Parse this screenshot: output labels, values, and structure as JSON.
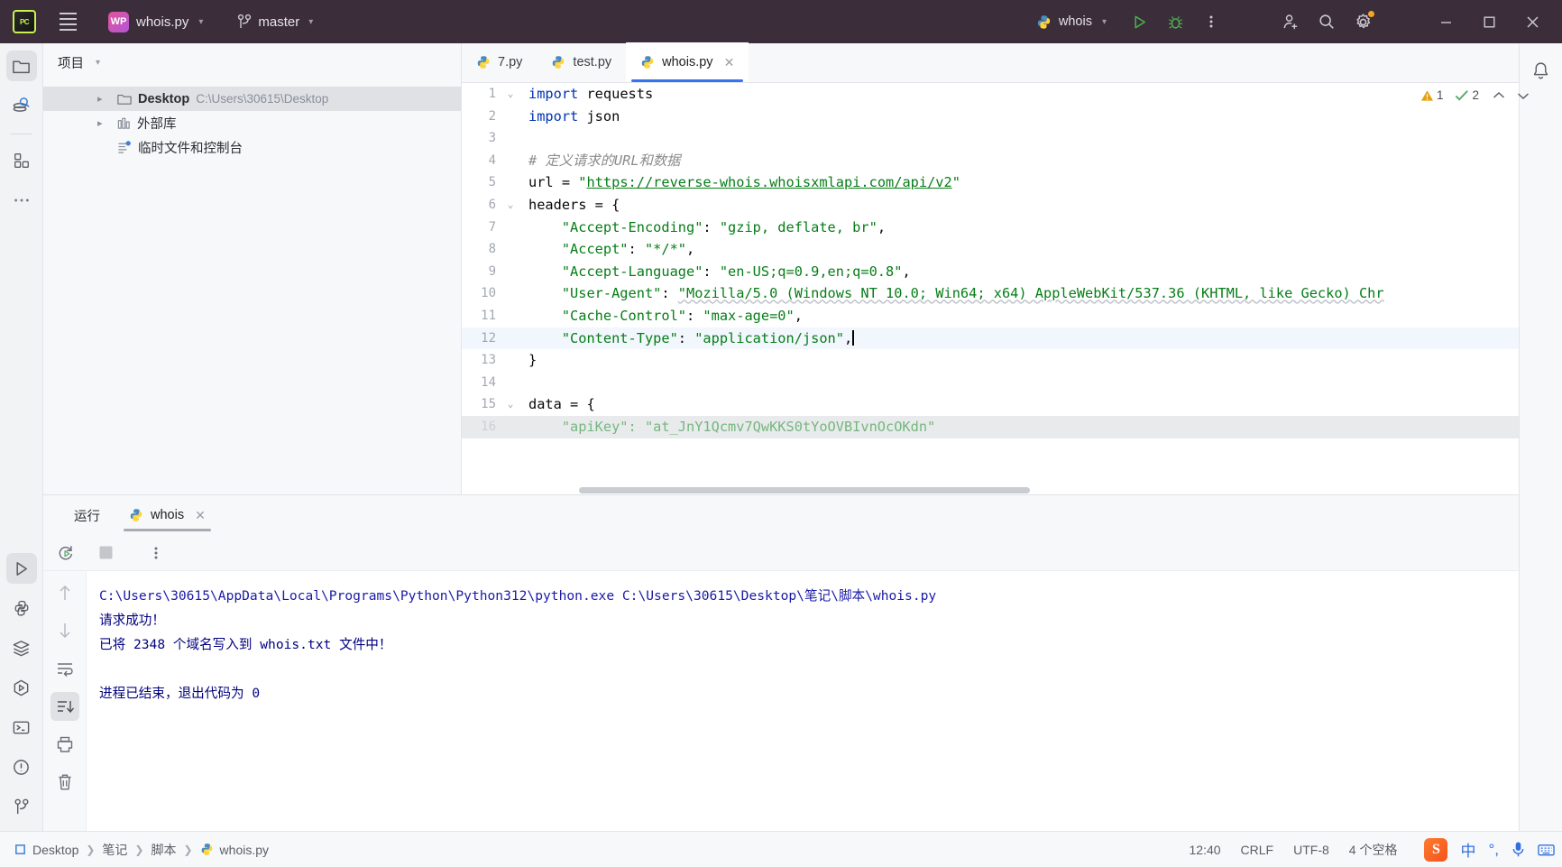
{
  "titlebar": {
    "logo_label": "PC",
    "menu_icon": "hamburger-menu-icon",
    "project_badge": "WP",
    "project_name": "whois.py",
    "branch_icon": "git-branch-icon",
    "branch_name": "master",
    "run_config": "whois",
    "run_icon": "run-icon",
    "debug_icon": "debug-icon",
    "more_icon": "more-vertical-icon",
    "share_icon": "add-user-icon",
    "search_icon": "search-icon",
    "settings_icon": "gear-icon",
    "minimize": "─",
    "maximize": "□",
    "close": "✕"
  },
  "activitybar": {
    "items": [
      {
        "name": "project-icon",
        "selected": true
      },
      {
        "name": "database-search-icon",
        "selected": false
      },
      {
        "name": "plugins-icon",
        "selected": false
      },
      {
        "name": "more-tools-icon",
        "selected": false
      }
    ],
    "bottom": [
      {
        "name": "run-tool-icon",
        "selected": true
      },
      {
        "name": "python-packages-icon",
        "selected": false
      },
      {
        "name": "structure-icon",
        "selected": false
      },
      {
        "name": "python-console-icon",
        "selected": false
      },
      {
        "name": "terminal-icon",
        "selected": false
      },
      {
        "name": "problems-icon",
        "selected": false
      },
      {
        "name": "version-control-icon",
        "selected": false
      }
    ]
  },
  "project_panel": {
    "title": "项目",
    "tree": [
      {
        "name": "Desktop",
        "path": "C:\\Users\\30615\\Desktop",
        "icon": "folder-icon",
        "expandable": true,
        "selected": true
      },
      {
        "name": "外部库",
        "path": "",
        "icon": "library-icon",
        "expandable": true,
        "selected": false
      },
      {
        "name": "临时文件和控制台",
        "path": "",
        "icon": "scratches-icon",
        "expandable": false,
        "selected": false
      }
    ]
  },
  "editor": {
    "tabs": [
      {
        "label": "7.py",
        "icon": "python-file-icon",
        "active": false,
        "closable": false
      },
      {
        "label": "test.py",
        "icon": "python-file-icon",
        "active": false,
        "closable": false
      },
      {
        "label": "whois.py",
        "icon": "python-file-icon",
        "active": true,
        "closable": true
      }
    ],
    "more_icon": "more-vertical-icon",
    "inspections": {
      "warning_icon": "warning-triangle-icon",
      "warning_count": "1",
      "ok_icon": "check-icon",
      "ok_count": "2",
      "up_icon": "chevron-up-icon",
      "down_icon": "chevron-down-icon"
    },
    "lines": [
      {
        "n": "1",
        "fold": "v",
        "cur": false,
        "segs": [
          {
            "t": "import",
            "c": "k"
          },
          {
            "t": " requests",
            "c": "plain"
          }
        ]
      },
      {
        "n": "2",
        "fold": "",
        "cur": false,
        "segs": [
          {
            "t": "import",
            "c": "k"
          },
          {
            "t": " json",
            "c": "plain"
          }
        ]
      },
      {
        "n": "3",
        "fold": "",
        "cur": false,
        "segs": []
      },
      {
        "n": "4",
        "fold": "",
        "cur": false,
        "segs": [
          {
            "t": "# 定义请求的URL和数据",
            "c": "cm"
          }
        ]
      },
      {
        "n": "5",
        "fold": "",
        "cur": false,
        "segs": [
          {
            "t": "url = ",
            "c": "plain"
          },
          {
            "t": "\"",
            "c": "s"
          },
          {
            "t": "https://reverse-whois.whoisxmlapi.com/api/v2",
            "c": "lnk"
          },
          {
            "t": "\"",
            "c": "s"
          }
        ]
      },
      {
        "n": "6",
        "fold": "v",
        "cur": false,
        "segs": [
          {
            "t": "headers = {",
            "c": "plain"
          }
        ]
      },
      {
        "n": "7",
        "fold": "",
        "cur": false,
        "segs": [
          {
            "t": "    ",
            "c": "plain"
          },
          {
            "t": "\"Accept-Encoding\"",
            "c": "s"
          },
          {
            "t": ": ",
            "c": "plain"
          },
          {
            "t": "\"gzip, deflate, br\"",
            "c": "s"
          },
          {
            "t": ",",
            "c": "plain"
          }
        ]
      },
      {
        "n": "8",
        "fold": "",
        "cur": false,
        "segs": [
          {
            "t": "    ",
            "c": "plain"
          },
          {
            "t": "\"Accept\"",
            "c": "s"
          },
          {
            "t": ": ",
            "c": "plain"
          },
          {
            "t": "\"*/*\"",
            "c": "s"
          },
          {
            "t": ",",
            "c": "plain"
          }
        ]
      },
      {
        "n": "9",
        "fold": "",
        "cur": false,
        "segs": [
          {
            "t": "    ",
            "c": "plain"
          },
          {
            "t": "\"Accept-Language\"",
            "c": "s"
          },
          {
            "t": ": ",
            "c": "plain"
          },
          {
            "t": "\"en-US;q=0.9,en;q=0.8\"",
            "c": "s"
          },
          {
            "t": ",",
            "c": "plain"
          }
        ]
      },
      {
        "n": "10",
        "fold": "",
        "cur": false,
        "segs": [
          {
            "t": "    ",
            "c": "plain"
          },
          {
            "t": "\"User-Agent\"",
            "c": "s"
          },
          {
            "t": ": ",
            "c": "plain"
          },
          {
            "t": "\"Mozilla/5.0 (Windows NT 10.0; Win64; x64) AppleWebKit/537.36 (KHTML, like Gecko) Chr",
            "c": "s wavy"
          }
        ]
      },
      {
        "n": "11",
        "fold": "",
        "cur": false,
        "segs": [
          {
            "t": "    ",
            "c": "plain"
          },
          {
            "t": "\"Cache-Control\"",
            "c": "s"
          },
          {
            "t": ": ",
            "c": "plain"
          },
          {
            "t": "\"max-age=0\"",
            "c": "s"
          },
          {
            "t": ",",
            "c": "plain"
          }
        ]
      },
      {
        "n": "12",
        "fold": "",
        "cur": true,
        "segs": [
          {
            "t": "    ",
            "c": "plain"
          },
          {
            "t": "\"Content-Type\"",
            "c": "s"
          },
          {
            "t": ": ",
            "c": "plain"
          },
          {
            "t": "\"application/json\"",
            "c": "s"
          },
          {
            "t": ",",
            "c": "plain"
          }
        ]
      },
      {
        "n": "13",
        "fold": "",
        "cur": false,
        "segs": [
          {
            "t": "}",
            "c": "plain"
          }
        ]
      },
      {
        "n": "14",
        "fold": "",
        "cur": false,
        "segs": []
      },
      {
        "n": "15",
        "fold": "v",
        "cur": false,
        "segs": [
          {
            "t": "data = {",
            "c": "plain"
          }
        ]
      },
      {
        "n": "16",
        "fold": "",
        "cur": false,
        "segs": [
          {
            "t": "    ",
            "c": "plain"
          },
          {
            "t": "\"apiKey\": \"at_JnY1Qcmv7QwKKS0tYoOVBIvnOcOKdn\"",
            "c": "s"
          }
        ]
      }
    ]
  },
  "run_panel": {
    "title": "运行",
    "tab_label": "whois",
    "tab_icon": "python-file-icon",
    "close_icon": "close-icon",
    "toolbar": [
      {
        "name": "rerun-icon"
      },
      {
        "name": "stop-icon"
      },
      {
        "name": "more-vertical-icon"
      }
    ],
    "side_icons": [
      {
        "name": "scroll-up-icon",
        "selected": false
      },
      {
        "name": "scroll-down-icon",
        "selected": false
      },
      {
        "name": "soft-wrap-icon",
        "selected": false
      },
      {
        "name": "scroll-to-end-icon",
        "selected": true
      },
      {
        "name": "print-icon",
        "selected": false
      },
      {
        "name": "clear-all-icon",
        "selected": false
      }
    ],
    "console_lines": [
      "C:\\Users\\30615\\AppData\\Local\\Programs\\Python\\Python312\\python.exe C:\\Users\\30615\\Desktop\\笔记\\脚本\\whois.py",
      "请求成功！",
      "已将 2348 个域名写入到 whois.txt 文件中！",
      "",
      "进程已结束，退出代码为 0"
    ]
  },
  "statusbar": {
    "breadcrumb": [
      {
        "label": "Desktop",
        "icon": "module-icon"
      },
      {
        "label": "笔记",
        "icon": ""
      },
      {
        "label": "脚本",
        "icon": ""
      },
      {
        "label": "whois.py",
        "icon": "python-file-icon"
      }
    ],
    "time": "12:40",
    "line_sep": "CRLF",
    "encoding": "UTF-8",
    "indent": "4 个空格",
    "ime_logo": "S",
    "ime_lang": "中",
    "ime_punct": "°,",
    "ime_mic": "microphone-icon",
    "ime_keyboard": "keyboard-icon"
  },
  "notifications": {
    "icon": "bell-icon"
  },
  "colors": {
    "titlebar_bg": "#3b2d3a",
    "accent_blue": "#3574f0",
    "string_green": "#067d17",
    "keyword_blue": "#0033b3",
    "console_navy": "#000080",
    "warning_amber": "#e3a008"
  }
}
